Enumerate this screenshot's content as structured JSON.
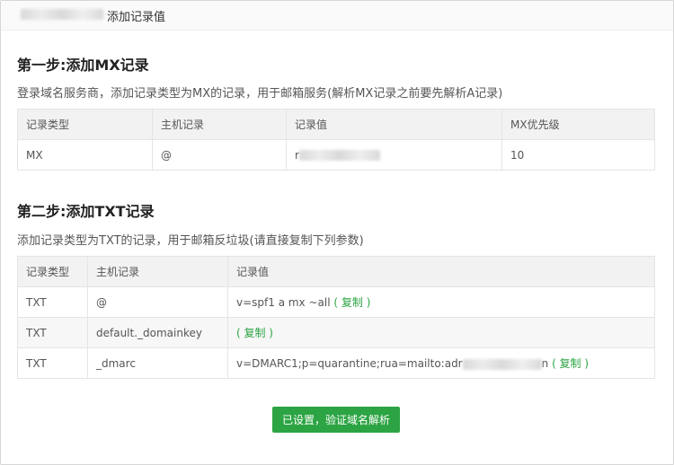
{
  "dialog": {
    "title": "添加记录值"
  },
  "step1": {
    "title": "第一步:添加MX记录",
    "description": "登录域名服务商，添加记录类型为MX的记录，用于邮箱服务(解析MX记录之前要先解析A记录)",
    "headers": [
      "记录类型",
      "主机记录",
      "记录值",
      "MX优先级"
    ],
    "rows": [
      {
        "type": "MX",
        "host": "@",
        "value": "r",
        "priority": "10"
      }
    ]
  },
  "step2": {
    "title": "第二步:添加TXT记录",
    "description": "添加记录类型为TXT的记录，用于邮箱反垃圾(请直接复制下列参数)",
    "headers": [
      "记录类型",
      "主机记录",
      "记录值"
    ],
    "copy_label": "( 复制 )",
    "rows": [
      {
        "type": "TXT",
        "host": "@",
        "value": "v=spf1 a mx ~all",
        "suffix": ""
      },
      {
        "type": "TXT",
        "host": "default._domainkey",
        "value": "",
        "suffix": ""
      },
      {
        "type": "TXT",
        "host": "_dmarc",
        "value": "v=DMARC1;p=quarantine;rua=mailto:adr",
        "suffix": "n"
      }
    ]
  },
  "verify_button": {
    "label": "已设置，验证域名解析"
  },
  "colors": {
    "accent": "#2ca443",
    "header_bg": "#f2f2f2"
  }
}
